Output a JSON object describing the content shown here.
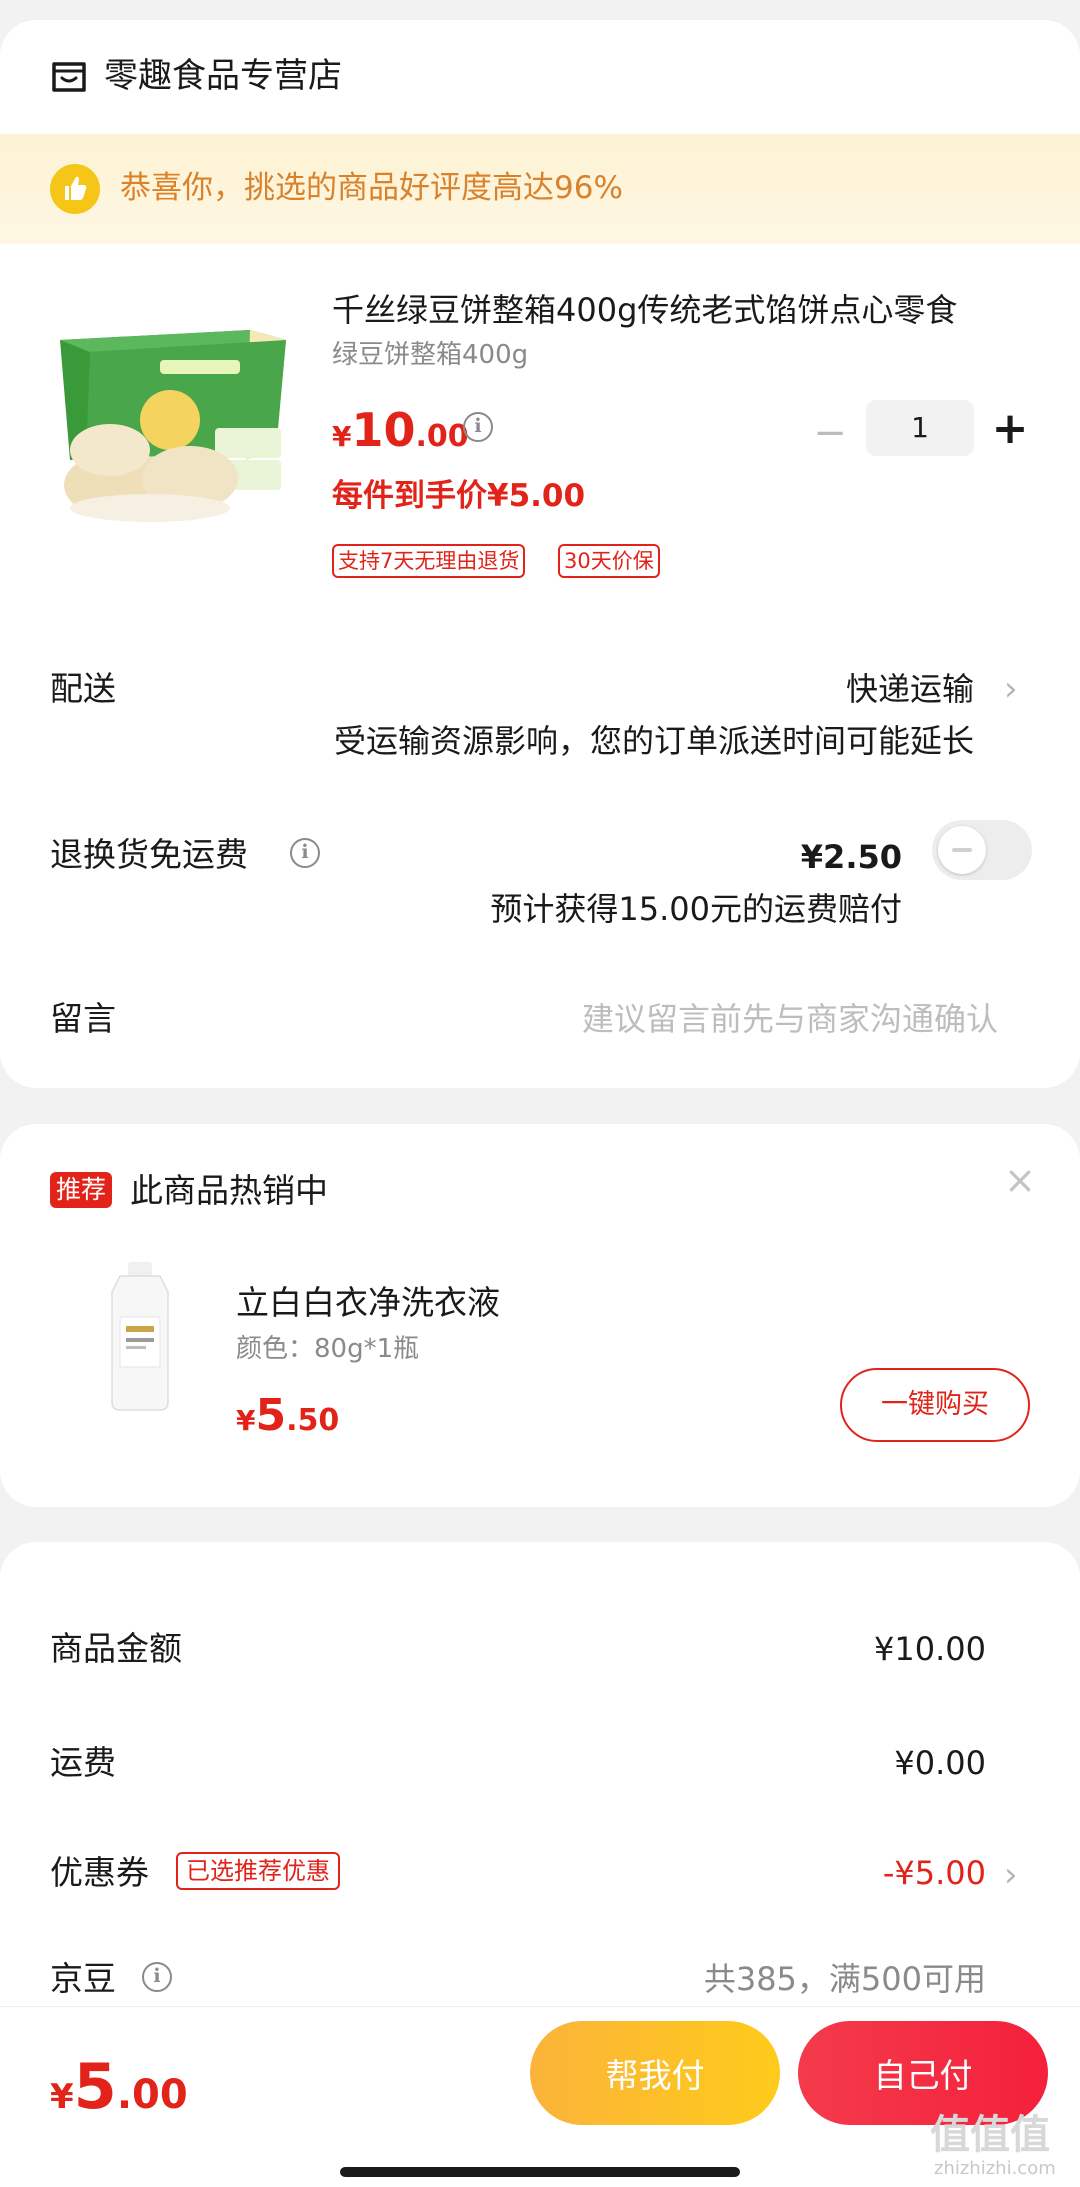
{
  "store": {
    "name": "零趣食品专营店",
    "icon": "store-icon"
  },
  "banner": {
    "text": "恭喜你，挑选的商品好评度高达96%",
    "icon": "thumbs-up-icon"
  },
  "product": {
    "title": "千丝绿豆饼整箱400g传统老式馅饼点心零食",
    "subtitle": "绿豆饼整箱400g",
    "price_currency": "¥",
    "price_int": "10",
    "price_dec": ".00",
    "unit_price": "每件到手价¥5.00",
    "tags": [
      "支持7天无理由退货",
      "30天价保"
    ],
    "quantity": "1",
    "minus": "−",
    "plus": "+"
  },
  "delivery": {
    "label": "配送",
    "value": "快递运输",
    "note": "受运输资源影响，您的订单派送时间可能延长"
  },
  "return_shipping": {
    "label": "退换货免运费",
    "price": "¥2.50",
    "note": "预计获得15.00元的运费赔付",
    "enabled": false
  },
  "message": {
    "label": "留言",
    "placeholder": "建议留言前先与商家沟通确认",
    "value": ""
  },
  "recommend": {
    "badge": "推荐",
    "title": "此商品热销中",
    "close": "×",
    "product_name": "立白白衣净洗衣液",
    "spec": "颜色：80g*1瓶",
    "price_currency": "¥",
    "price_int": "5",
    "price_dec": ".50",
    "buy_label": "一键购买"
  },
  "summary": {
    "goods_label": "商品金额",
    "goods_value": "¥10.00",
    "shipping_label": "运费",
    "shipping_value": "¥0.00",
    "coupon_label": "优惠券",
    "coupon_tag": "已选推荐优惠",
    "coupon_value": "-¥5.00",
    "beans_label": "京豆",
    "beans_value": "共385，满500可用"
  },
  "bottom": {
    "total_currency": "¥",
    "total_int": "5",
    "total_dec": ".00",
    "help_pay": "帮我付",
    "self_pay": "自己付",
    "watermark": "值值值",
    "watermark_sub": "zhizhizhi.com"
  },
  "colors": {
    "accent_red": "#e2231a",
    "help_button": "#fdbf24",
    "self_button": "#f43b4b",
    "banner_text": "#d9822b"
  }
}
